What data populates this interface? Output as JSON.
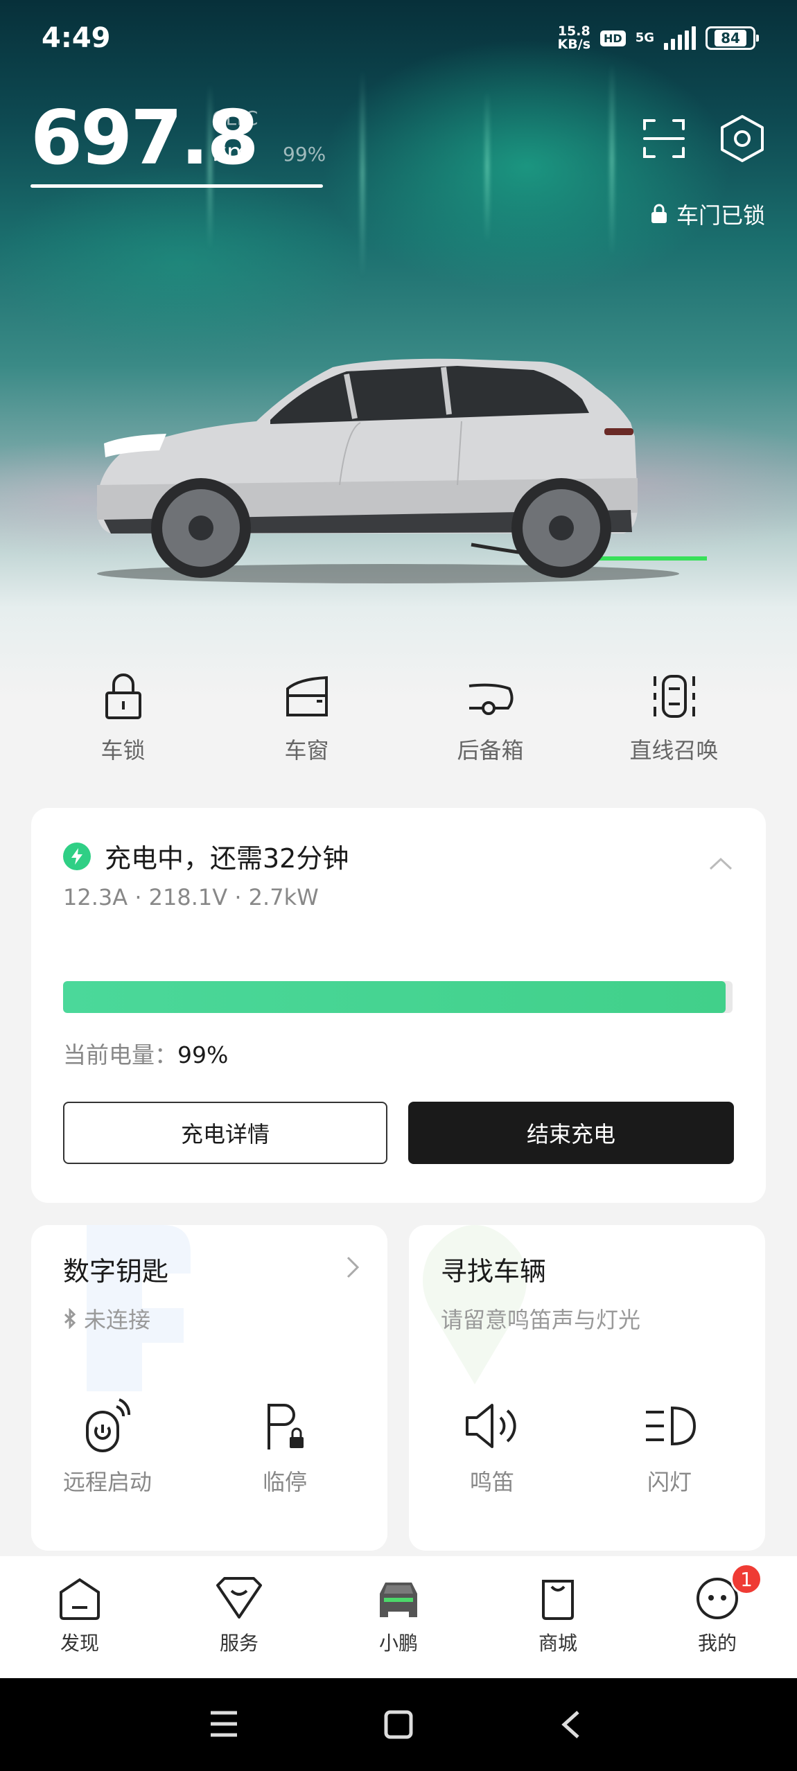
{
  "status_bar": {
    "time": "4:49",
    "net_speed_value": "15.8",
    "net_speed_unit": "KB/s",
    "hd": "HD",
    "network": "5G",
    "battery": "84"
  },
  "range": {
    "value": "697.8",
    "standard": "CLTC",
    "unit": "km",
    "percent": "99%"
  },
  "door": {
    "status": "车门已锁"
  },
  "quick_actions": [
    {
      "label": "车锁",
      "icon": "lock-icon"
    },
    {
      "label": "车窗",
      "icon": "window-icon"
    },
    {
      "label": "后备箱",
      "icon": "trunk-icon"
    },
    {
      "label": "直线召唤",
      "icon": "summon-icon"
    }
  ],
  "charging": {
    "title": "充电中，还需32分钟",
    "stats": "12.3A · 218.1V · 2.7kW",
    "progress": 0.99,
    "current_label": "当前电量：",
    "current_value": "99%",
    "detail_button": "充电详情",
    "end_button": "结束充电",
    "accent": "#2fcf85"
  },
  "digital_key": {
    "title": "数字钥匙",
    "status": "未连接",
    "actions": [
      {
        "label": "远程启动",
        "icon": "remote-start-icon"
      },
      {
        "label": "临停",
        "icon": "parking-lock-icon"
      }
    ]
  },
  "find_car": {
    "title": "寻找车辆",
    "subtitle": "请留意鸣笛声与灯光",
    "actions": [
      {
        "label": "鸣笛",
        "icon": "horn-icon"
      },
      {
        "label": "闪灯",
        "icon": "flash-lights-icon"
      }
    ]
  },
  "tabs": [
    {
      "label": "发现",
      "icon": "discover-icon"
    },
    {
      "label": "服务",
      "icon": "service-icon"
    },
    {
      "label": "小鹏",
      "icon": "car-icon",
      "active": true
    },
    {
      "label": "商城",
      "icon": "mall-icon"
    },
    {
      "label": "我的",
      "icon": "profile-icon",
      "badge": "1"
    }
  ]
}
